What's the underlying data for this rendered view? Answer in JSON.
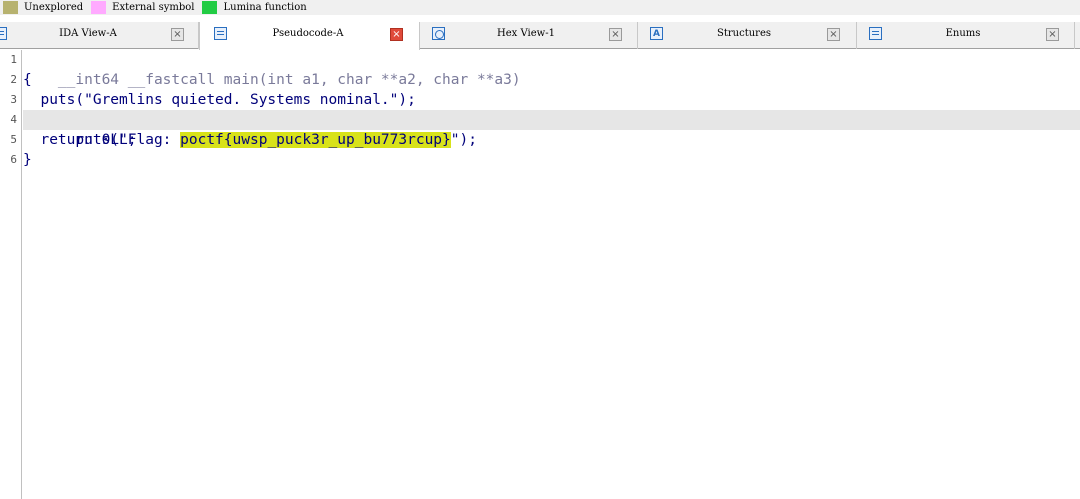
{
  "legend": [
    {
      "label": "Unexplored",
      "color": "#b7b26f"
    },
    {
      "label": "External symbol",
      "color": "#ffaaff"
    },
    {
      "label": "Lumina function",
      "color": "#22cc44"
    }
  ],
  "tabs": [
    {
      "label": "IDA View-A",
      "icon": "ida-view-icon"
    },
    {
      "label": "Pseudocode-A",
      "icon": "pseudocode-icon"
    },
    {
      "label": "Hex View-1",
      "icon": "hex-view-icon"
    },
    {
      "label": "Structures",
      "icon": "structures-icon",
      "letter": "A"
    },
    {
      "label": "Enums",
      "icon": "enums-icon"
    }
  ],
  "active_tab": "Pseudocode-A",
  "code": {
    "line_numbers": [
      "1",
      "2",
      "3",
      "4",
      "5",
      "6"
    ],
    "line1": "__int64 __fastcall main(int a1, char **a2, char **a3)",
    "line2": "{",
    "line3": "  puts(\"Gremlins quieted. Systems nominal.\");",
    "line4_pre": "  puts(\"Flag: ",
    "line4_flag": "poctf{uwsp_puck3r_up_bu773rcup}",
    "line4_post": "\");",
    "line5": "  return 0LL;",
    "line6": "}"
  },
  "highlight_color": "#d8e21a"
}
